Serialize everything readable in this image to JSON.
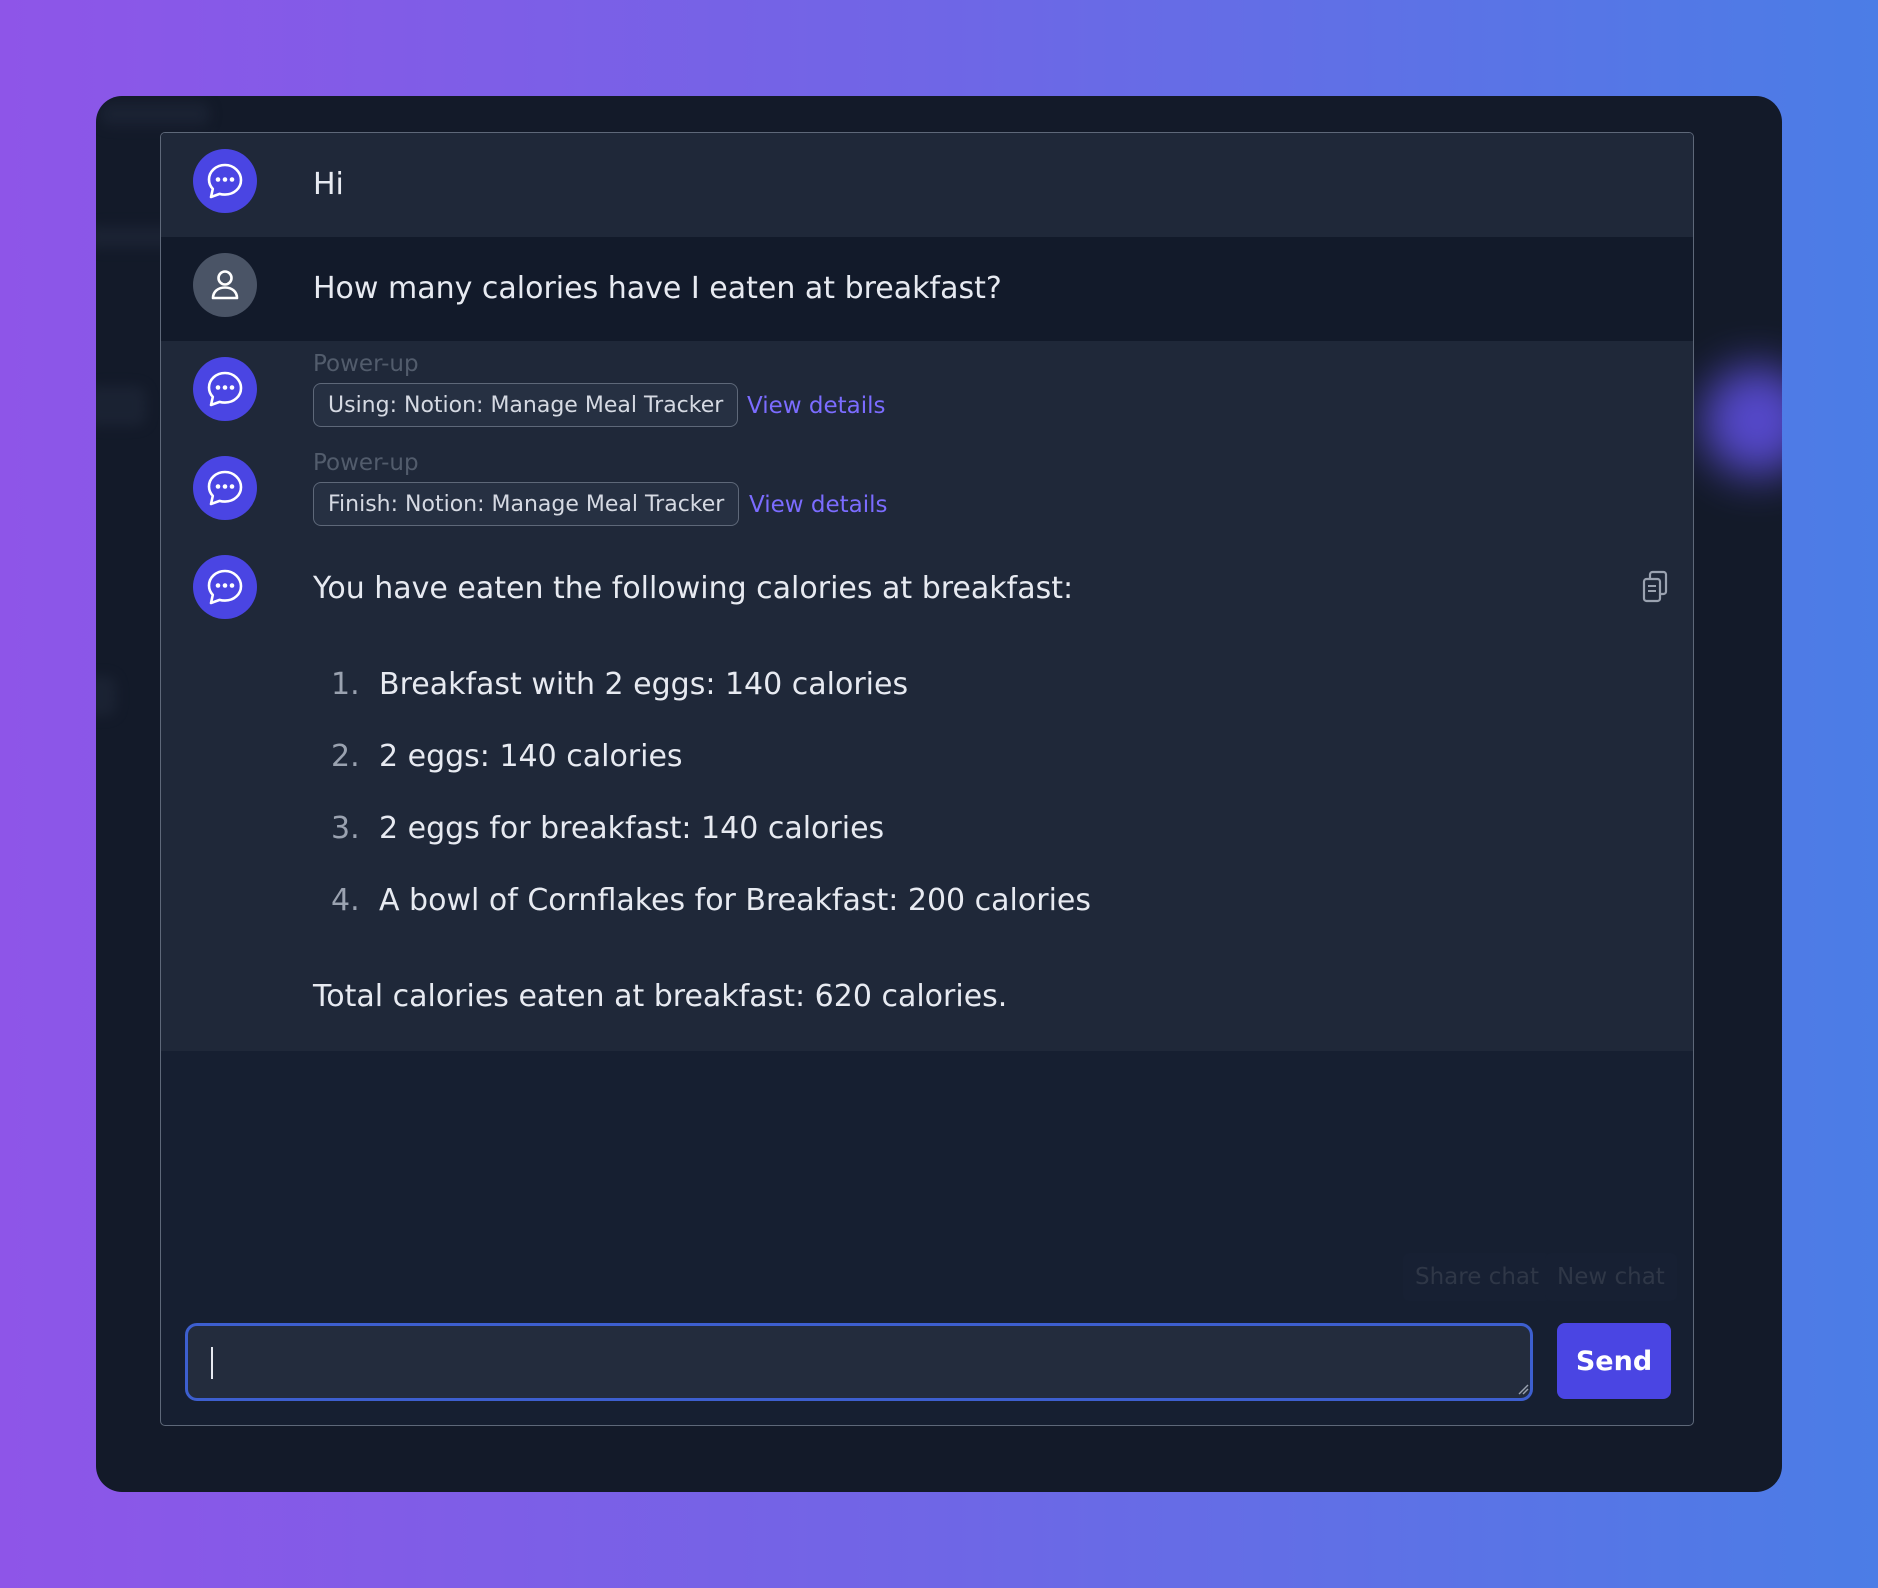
{
  "conversation": {
    "greeting": "Hi",
    "user_question": "How many calories have I eaten at breakfast?",
    "powerups": [
      {
        "label": "Power-up",
        "chip": "Using: Notion: Manage Meal Tracker",
        "link": "View details"
      },
      {
        "label": "Power-up",
        "chip": "Finish: Notion: Manage Meal Tracker",
        "link": "View details"
      }
    ],
    "answer": {
      "intro": "You have eaten the following calories at breakfast:",
      "items": [
        {
          "num": "1.",
          "text": "Breakfast with 2 eggs: 140 calories"
        },
        {
          "num": "2.",
          "text": "2 eggs: 140 calories"
        },
        {
          "num": "3.",
          "text": "2 eggs for breakfast: 140 calories"
        },
        {
          "num": "4.",
          "text": "A bowl of Cornflakes for Breakfast: 200 calories"
        }
      ],
      "total": "Total calories eaten at breakfast: 620 calories."
    }
  },
  "footer": {
    "share_label": "Share chat",
    "new_label": "New chat"
  },
  "composer": {
    "value": "",
    "send_label": "Send"
  },
  "colors": {
    "accent": "#4a45e3",
    "link": "#7b6cff",
    "input_focus": "#3d5fcf"
  }
}
